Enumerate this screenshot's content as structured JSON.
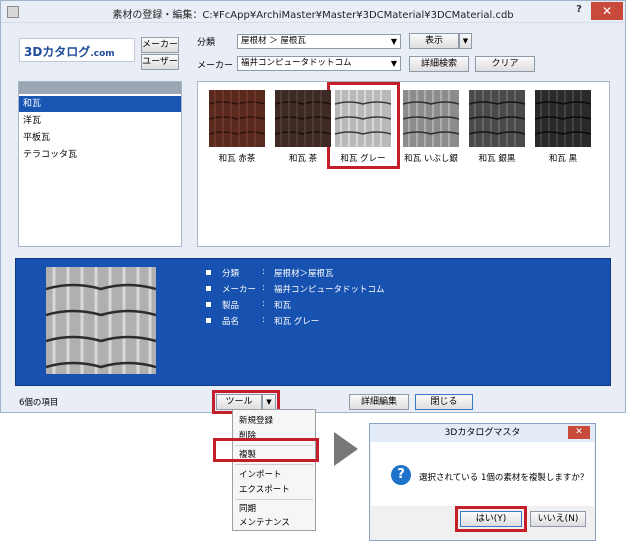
{
  "window": {
    "title": "素材の登録・編集：C:¥FcApp¥ArchiMaster¥Master¥3DCMaterial¥3DCMaterial.cdb",
    "help_label": "?",
    "close_label": "✕"
  },
  "logo": {
    "main": "3Dカタログ",
    "suffix": ".com"
  },
  "side_buttons": {
    "maker": "メーカー",
    "user": "ユーザー"
  },
  "filters": {
    "category_label": "分類",
    "category_value": "屋根材 ＞ 屋根瓦",
    "maker_label": "メーカー",
    "maker_value": "福井コンピュータドットコム",
    "display_button": "表示",
    "advanced_search_button": "詳細検索",
    "clear_button": "クリア"
  },
  "categories": [
    {
      "label": "和瓦"
    },
    {
      "label": "洋瓦"
    },
    {
      "label": "平板瓦"
    },
    {
      "label": "テラコッタ瓦"
    }
  ],
  "materials": [
    {
      "label": "和瓦 赤茶",
      "color": "#5a2a1f"
    },
    {
      "label": "和瓦 茶",
      "color": "#3d2a24"
    },
    {
      "label": "和瓦 グレー",
      "color": "#b9b9b9"
    },
    {
      "label": "和瓦 いぶし銀",
      "color": "#8c8c8c"
    },
    {
      "label": "和瓦 銀黒",
      "color": "#4a4a4a"
    },
    {
      "label": "和瓦 黒",
      "color": "#2a2a2a"
    }
  ],
  "details": [
    {
      "key": "分類",
      "sep": ":",
      "value": "屋根材＞屋根瓦"
    },
    {
      "key": "メーカー",
      "sep": ":",
      "value": "福井コンピュータドットコム"
    },
    {
      "key": "製品",
      "sep": ":",
      "value": "和瓦"
    },
    {
      "key": "品名",
      "sep": ":",
      "value": "和瓦 グレー"
    }
  ],
  "status": {
    "item_count": "6個の項目"
  },
  "bottom_buttons": {
    "tool": "ツール",
    "edit_detail": "詳細編集",
    "close": "閉じる"
  },
  "tool_menu": {
    "items": [
      "新規登録",
      "削除",
      "複製",
      "インポート",
      "エクスポート",
      "同期",
      "メンテナンス"
    ]
  },
  "dialog": {
    "title": "3Dカタログマスタ",
    "close_label": "✕",
    "message": "選択されている 1個の素材を複製しますか？",
    "yes_button": "はい(Y)",
    "no_button": "いいえ(N)"
  },
  "colors": {
    "accent": "#1852b0",
    "highlight": "#c41e2a",
    "selection": "#1a56b3"
  }
}
